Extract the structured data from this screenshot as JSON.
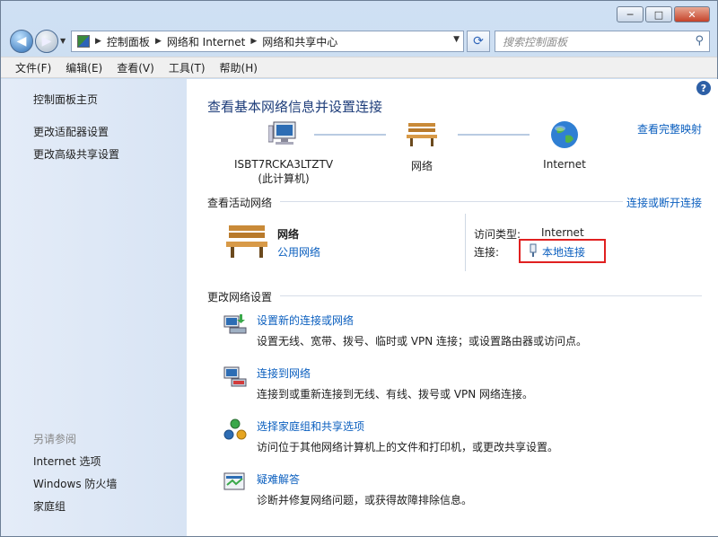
{
  "window": {
    "buttons": {
      "minimize": "─",
      "maximize": "□",
      "close": "✕"
    }
  },
  "nav": {
    "breadcrumb": [
      "控制面板",
      "网络和 Internet",
      "网络和共享中心"
    ],
    "search_placeholder": "搜索控制面板"
  },
  "menu": [
    "文件(F)",
    "编辑(E)",
    "查看(V)",
    "工具(T)",
    "帮助(H)"
  ],
  "sidebar": {
    "links": [
      "控制面板主页",
      "更改适配器设置",
      "更改高级共享设置"
    ],
    "see_also": "另请参阅",
    "see_also_links": [
      "Internet 选项",
      "Windows 防火墙",
      "家庭组"
    ]
  },
  "content": {
    "title": "查看基本网络信息并设置连接",
    "full_map_link": "查看完整映射",
    "map": {
      "computer_line1": "ISBT7RCKA3LTZTV",
      "computer_line2": "(此计算机)",
      "network": "网络",
      "internet": "Internet"
    },
    "active_header": "查看活动网络",
    "connect_link": "连接或断开连接",
    "active": {
      "name": "网络",
      "type_link": "公用网络",
      "access_label": "访问类型:",
      "access_value": "Internet",
      "connection_label": "连接:",
      "connection_link": "本地连接"
    },
    "change_header": "更改网络设置",
    "tasks": [
      {
        "title": "设置新的连接或网络",
        "desc": "设置无线、宽带、拨号、临时或 VPN 连接；或设置路由器或访问点。"
      },
      {
        "title": "连接到网络",
        "desc": "连接到或重新连接到无线、有线、拨号或 VPN 网络连接。"
      },
      {
        "title": "选择家庭组和共享选项",
        "desc": "访问位于其他网络计算机上的文件和打印机，或更改共享设置。"
      },
      {
        "title": "疑难解答",
        "desc": "诊断并修复网络问题，或获得故障排除信息。"
      }
    ]
  }
}
